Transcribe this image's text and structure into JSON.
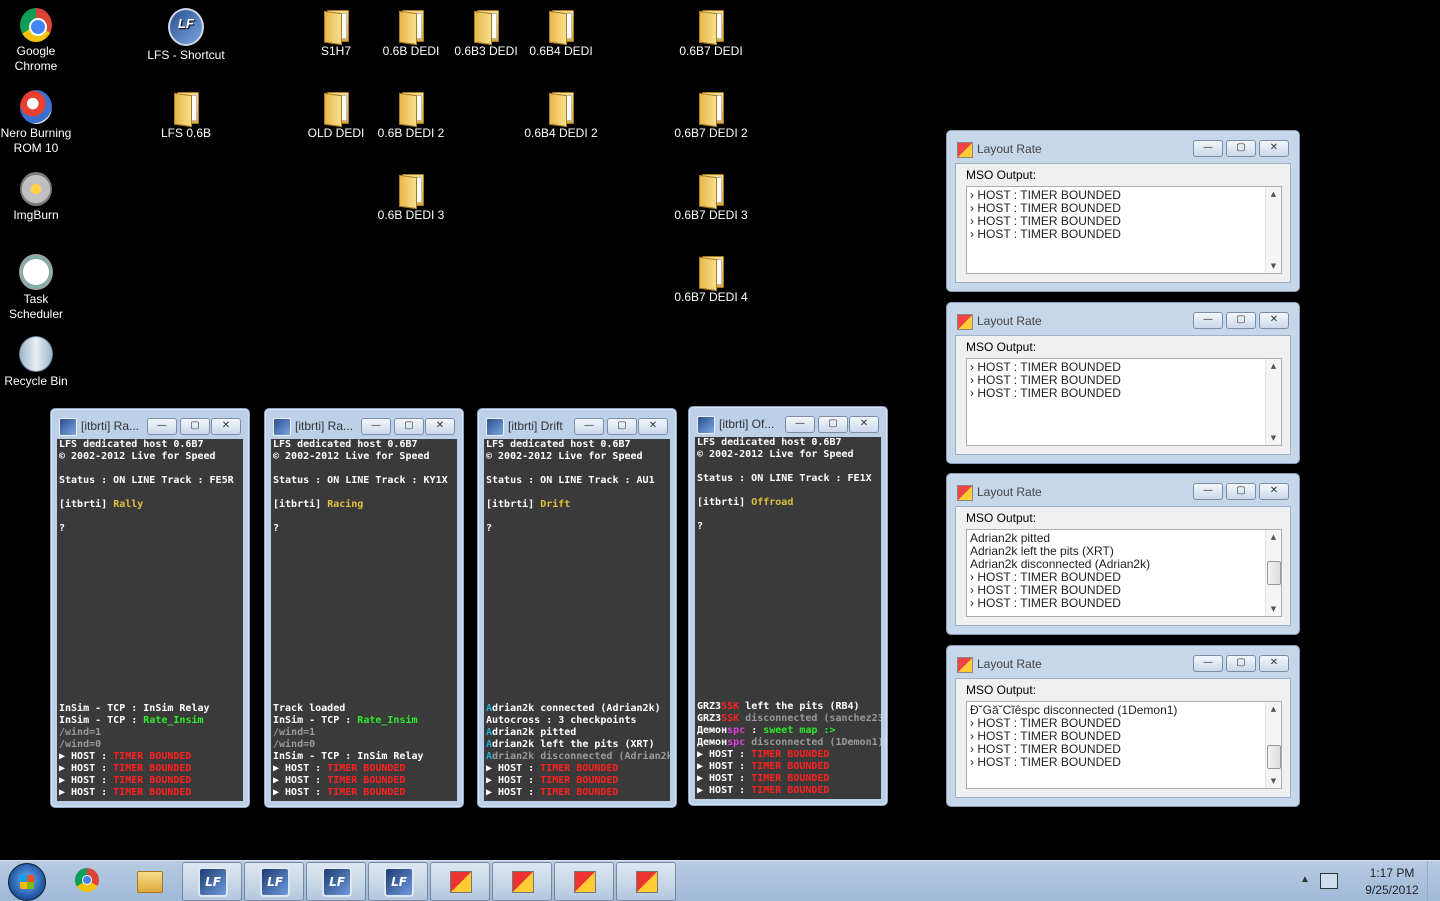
{
  "desktop": {
    "icons": [
      {
        "label": "Google Chrome",
        "kind": "chrome"
      },
      {
        "label": "LFS - Shortcut",
        "kind": "lfs"
      },
      {
        "label": "S1H7",
        "kind": "folder"
      },
      {
        "label": "0.6B DEDI",
        "kind": "folder"
      },
      {
        "label": "0.6B3 DEDI",
        "kind": "folder"
      },
      {
        "label": "0.6B4 DEDI",
        "kind": "folder"
      },
      {
        "label": "0.6B7 DEDI",
        "kind": "folder"
      },
      {
        "label": "Nero Burning ROM 10",
        "kind": "nero"
      },
      {
        "label": "LFS 0.6B",
        "kind": "folder"
      },
      {
        "label": "OLD DEDI",
        "kind": "folder"
      },
      {
        "label": "0.6B DEDI 2",
        "kind": "folder"
      },
      {
        "label": "0.6B4 DEDI 2",
        "kind": "folder"
      },
      {
        "label": "0.6B7 DEDI 2",
        "kind": "folder"
      },
      {
        "label": "ImgBurn",
        "kind": "imgburn"
      },
      {
        "label": "0.6B DEDI 3",
        "kind": "folder"
      },
      {
        "label": "0.6B7 DEDI 3",
        "kind": "folder"
      },
      {
        "label": "Task Scheduler",
        "kind": "task"
      },
      {
        "label": "0.6B7 DEDI 4",
        "kind": "folder"
      },
      {
        "label": "Recycle Bin",
        "kind": "recycle-bin"
      }
    ]
  },
  "lfs_windows": [
    {
      "title": "[itbrti] Ra...",
      "header1": "LFS dedicated host 0.6B7",
      "header2": "© 2002-2012 Live for Speed",
      "status": "Status : ON LINE",
      "track": "Track : FE5R",
      "tag": "[itbrti]",
      "mode": "Rally",
      "prompt": "?",
      "log": [
        [
          "w",
          "InSim - TCP : InSim Relay"
        ],
        [
          "w",
          "InSim - TCP : ",
          "g",
          "Rate_Insim"
        ],
        [
          "gr",
          "/wind=1"
        ],
        [
          "gr",
          "/wind=0"
        ],
        [
          "w",
          "▶ HOST : ",
          "r",
          "TIMER BOUNDED"
        ],
        [
          "w",
          "▶ HOST : ",
          "r",
          "TIMER BOUNDED"
        ],
        [
          "w",
          "▶ HOST : ",
          "r",
          "TIMER BOUNDED"
        ],
        [
          "w",
          "▶ HOST : ",
          "r",
          "TIMER BOUNDED"
        ]
      ]
    },
    {
      "title": "[itbrti] Ra...",
      "header1": "LFS dedicated host 0.6B7",
      "header2": "© 2002-2012 Live for Speed",
      "status": "Status : ON LINE",
      "track": "Track : KY1X",
      "tag": "[itbrti]",
      "mode": "Racing",
      "prompt": "?",
      "log": [
        [
          "w",
          "Track loaded"
        ],
        [
          "w",
          "InSim - TCP : ",
          "g",
          "Rate_Insim"
        ],
        [
          "gr",
          "/wind=1"
        ],
        [
          "gr",
          "/wind=0"
        ],
        [
          "w",
          "InSim - TCP : InSim Relay"
        ],
        [
          "w",
          "▶ HOST : ",
          "r",
          "TIMER BOUNDED"
        ],
        [
          "w",
          "▶ HOST : ",
          "r",
          "TIMER BOUNDED"
        ],
        [
          "w",
          "▶ HOST : ",
          "r",
          "TIMER BOUNDED"
        ]
      ]
    },
    {
      "title": "[itbrti] Drift",
      "header1": "LFS dedicated host 0.6B7",
      "header2": "© 2002-2012 Live for Speed",
      "status": "Status : ON LINE",
      "track": "Track : AU1",
      "tag": "[itbrti]",
      "mode": "Drift",
      "prompt": "?",
      "log": [
        [
          "c",
          "A",
          "w",
          "drian2k connected (Adrian2k)"
        ],
        [
          "w",
          "Autocross : 3 checkpoints"
        ],
        [
          "c",
          "A",
          "w",
          "drian2k pitted"
        ],
        [
          "c",
          "A",
          "w",
          "drian2k left the pits (XRT)"
        ],
        [
          "c",
          "A",
          "gr",
          "drian2k disconnected (Adrian2k)"
        ],
        [
          "w",
          "▶ HOST : ",
          "r",
          "TIMER BOUNDED"
        ],
        [
          "w",
          "▶ HOST : ",
          "r",
          "TIMER BOUNDED"
        ],
        [
          "w",
          "▶ HOST : ",
          "r",
          "TIMER BOUNDED"
        ]
      ]
    },
    {
      "title": "[itbrti] Of...",
      "header1": "LFS dedicated host 0.6B7",
      "header2": "© 2002-2012 Live for Speed",
      "status": "Status : ON LINE",
      "track": "Track : FE1X",
      "tag": "[itbrti]",
      "mode": "Offroad",
      "prompt": "?",
      "log": [
        [
          "w",
          "GRZ3",
          "r",
          "SSK",
          "w",
          " left the pits (RB4)"
        ],
        [
          "w",
          "GRZ3",
          "r",
          "SSK",
          "gr",
          " disconnected (sanchez23)"
        ],
        [
          "w",
          "Демон",
          "m",
          "spc",
          "w",
          " : ",
          "g",
          "sweet map :>"
        ],
        [
          "w",
          "Демон",
          "m",
          "spc",
          "gr",
          " disconnected (1Demon1)"
        ],
        [
          "w",
          "▶ HOST : ",
          "r",
          "TIMER BOUNDED"
        ],
        [
          "w",
          "▶ HOST : ",
          "r",
          "TIMER BOUNDED"
        ],
        [
          "w",
          "▶ HOST : ",
          "r",
          "TIMER BOUNDED"
        ],
        [
          "w",
          "▶ HOST : ",
          "r",
          "TIMER BOUNDED"
        ]
      ]
    }
  ],
  "layout_rate_windows": [
    {
      "title": "Layout Rate",
      "label": "MSO Output:",
      "rows": [
        "› HOST : TIMER BOUNDED",
        "› HOST : TIMER BOUNDED",
        "› HOST : TIMER BOUNDED",
        "› HOST : TIMER BOUNDED"
      ],
      "thumb": null
    },
    {
      "title": "Layout Rate",
      "label": "MSO Output:",
      "rows": [
        "› HOST : TIMER BOUNDED",
        "› HOST : TIMER BOUNDED",
        "› HOST : TIMER BOUNDED"
      ],
      "thumb": null
    },
    {
      "title": "Layout Rate",
      "label": "MSO Output:",
      "rows": [
        "Adrian2k pitted",
        "Adrian2k left the pits (XRT)",
        "Adrian2k disconnected (Adrian2k)",
        "› HOST : TIMER BOUNDED",
        "› HOST : TIMER BOUNDED",
        "› HOST : TIMER BOUNDED"
      ],
      "thumb": 0.5
    },
    {
      "title": "Layout Rate",
      "label": "MSO Output:",
      "rows": [
        "Đ˘Gă˘Cĩêspc disconnected (1Demon1)",
        "› HOST : TIMER BOUNDED",
        "› HOST : TIMER BOUNDED",
        "› HOST : TIMER BOUNDED",
        "› HOST : TIMER BOUNDED"
      ],
      "thumb": 0.85
    }
  ],
  "window_buttons": {
    "minimize": "—",
    "maximize": "▢",
    "close": "✕"
  },
  "taskbar": {
    "items": [
      "chrome",
      "explorer",
      "lfs",
      "lfs",
      "lfs",
      "lfs",
      "layout-rate",
      "layout-rate",
      "layout-rate",
      "layout-rate"
    ],
    "time": "1:17 PM",
    "date": "9/25/2012",
    "tray_arrow": "▲"
  }
}
